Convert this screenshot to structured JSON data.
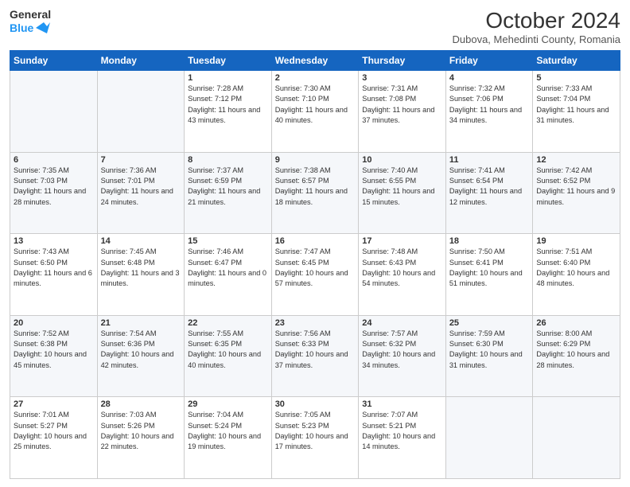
{
  "header": {
    "logo_line1": "General",
    "logo_line2": "Blue",
    "title": "October 2024",
    "subtitle": "Dubova, Mehedinti County, Romania"
  },
  "days_of_week": [
    "Sunday",
    "Monday",
    "Tuesday",
    "Wednesday",
    "Thursday",
    "Friday",
    "Saturday"
  ],
  "weeks": [
    [
      {
        "day": "",
        "info": ""
      },
      {
        "day": "",
        "info": ""
      },
      {
        "day": "1",
        "info": "Sunrise: 7:28 AM\nSunset: 7:12 PM\nDaylight: 11 hours and 43 minutes."
      },
      {
        "day": "2",
        "info": "Sunrise: 7:30 AM\nSunset: 7:10 PM\nDaylight: 11 hours and 40 minutes."
      },
      {
        "day": "3",
        "info": "Sunrise: 7:31 AM\nSunset: 7:08 PM\nDaylight: 11 hours and 37 minutes."
      },
      {
        "day": "4",
        "info": "Sunrise: 7:32 AM\nSunset: 7:06 PM\nDaylight: 11 hours and 34 minutes."
      },
      {
        "day": "5",
        "info": "Sunrise: 7:33 AM\nSunset: 7:04 PM\nDaylight: 11 hours and 31 minutes."
      }
    ],
    [
      {
        "day": "6",
        "info": "Sunrise: 7:35 AM\nSunset: 7:03 PM\nDaylight: 11 hours and 28 minutes."
      },
      {
        "day": "7",
        "info": "Sunrise: 7:36 AM\nSunset: 7:01 PM\nDaylight: 11 hours and 24 minutes."
      },
      {
        "day": "8",
        "info": "Sunrise: 7:37 AM\nSunset: 6:59 PM\nDaylight: 11 hours and 21 minutes."
      },
      {
        "day": "9",
        "info": "Sunrise: 7:38 AM\nSunset: 6:57 PM\nDaylight: 11 hours and 18 minutes."
      },
      {
        "day": "10",
        "info": "Sunrise: 7:40 AM\nSunset: 6:55 PM\nDaylight: 11 hours and 15 minutes."
      },
      {
        "day": "11",
        "info": "Sunrise: 7:41 AM\nSunset: 6:54 PM\nDaylight: 11 hours and 12 minutes."
      },
      {
        "day": "12",
        "info": "Sunrise: 7:42 AM\nSunset: 6:52 PM\nDaylight: 11 hours and 9 minutes."
      }
    ],
    [
      {
        "day": "13",
        "info": "Sunrise: 7:43 AM\nSunset: 6:50 PM\nDaylight: 11 hours and 6 minutes."
      },
      {
        "day": "14",
        "info": "Sunrise: 7:45 AM\nSunset: 6:48 PM\nDaylight: 11 hours and 3 minutes."
      },
      {
        "day": "15",
        "info": "Sunrise: 7:46 AM\nSunset: 6:47 PM\nDaylight: 11 hours and 0 minutes."
      },
      {
        "day": "16",
        "info": "Sunrise: 7:47 AM\nSunset: 6:45 PM\nDaylight: 10 hours and 57 minutes."
      },
      {
        "day": "17",
        "info": "Sunrise: 7:48 AM\nSunset: 6:43 PM\nDaylight: 10 hours and 54 minutes."
      },
      {
        "day": "18",
        "info": "Sunrise: 7:50 AM\nSunset: 6:41 PM\nDaylight: 10 hours and 51 minutes."
      },
      {
        "day": "19",
        "info": "Sunrise: 7:51 AM\nSunset: 6:40 PM\nDaylight: 10 hours and 48 minutes."
      }
    ],
    [
      {
        "day": "20",
        "info": "Sunrise: 7:52 AM\nSunset: 6:38 PM\nDaylight: 10 hours and 45 minutes."
      },
      {
        "day": "21",
        "info": "Sunrise: 7:54 AM\nSunset: 6:36 PM\nDaylight: 10 hours and 42 minutes."
      },
      {
        "day": "22",
        "info": "Sunrise: 7:55 AM\nSunset: 6:35 PM\nDaylight: 10 hours and 40 minutes."
      },
      {
        "day": "23",
        "info": "Sunrise: 7:56 AM\nSunset: 6:33 PM\nDaylight: 10 hours and 37 minutes."
      },
      {
        "day": "24",
        "info": "Sunrise: 7:57 AM\nSunset: 6:32 PM\nDaylight: 10 hours and 34 minutes."
      },
      {
        "day": "25",
        "info": "Sunrise: 7:59 AM\nSunset: 6:30 PM\nDaylight: 10 hours and 31 minutes."
      },
      {
        "day": "26",
        "info": "Sunrise: 8:00 AM\nSunset: 6:29 PM\nDaylight: 10 hours and 28 minutes."
      }
    ],
    [
      {
        "day": "27",
        "info": "Sunrise: 7:01 AM\nSunset: 5:27 PM\nDaylight: 10 hours and 25 minutes."
      },
      {
        "day": "28",
        "info": "Sunrise: 7:03 AM\nSunset: 5:26 PM\nDaylight: 10 hours and 22 minutes."
      },
      {
        "day": "29",
        "info": "Sunrise: 7:04 AM\nSunset: 5:24 PM\nDaylight: 10 hours and 19 minutes."
      },
      {
        "day": "30",
        "info": "Sunrise: 7:05 AM\nSunset: 5:23 PM\nDaylight: 10 hours and 17 minutes."
      },
      {
        "day": "31",
        "info": "Sunrise: 7:07 AM\nSunset: 5:21 PM\nDaylight: 10 hours and 14 minutes."
      },
      {
        "day": "",
        "info": ""
      },
      {
        "day": "",
        "info": ""
      }
    ]
  ]
}
